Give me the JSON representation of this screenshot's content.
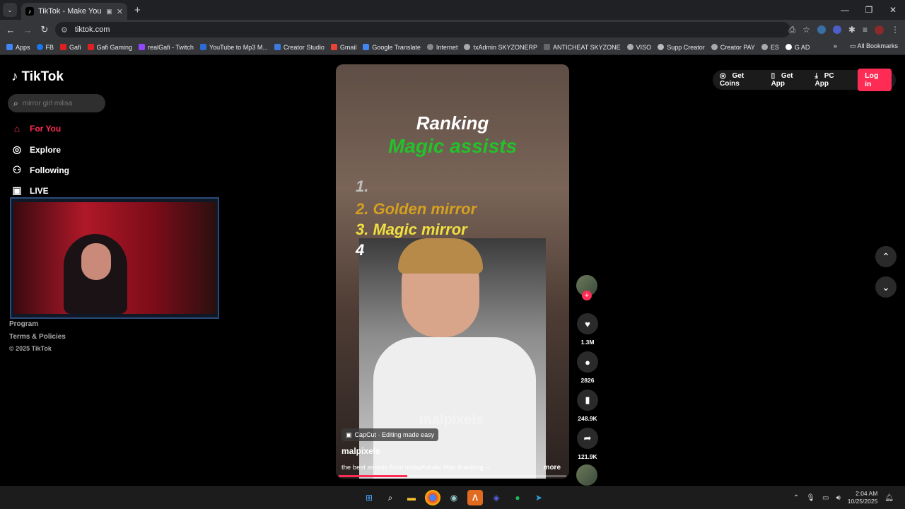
{
  "browser": {
    "tab_title": "TikTok - Make Your Day",
    "url": "tiktok.com",
    "bookmarks": [
      "Apps",
      "FB",
      "Gafi",
      "Gafi Gaming",
      "realGafi - Twitch",
      "YouTube to Mp3 M...",
      "Creator Studio",
      "Gmail",
      "Google Translate",
      "Internet",
      "txAdmin SKYZONERP",
      "ANTICHEAT SKYZONE",
      "VISO",
      "Supp Creator",
      "Creator PAY",
      "ES",
      "G AD"
    ],
    "all_bookmarks": "All Bookmarks"
  },
  "sidebar": {
    "logo": "TikTok",
    "search_placeholder": "mirror girl milisa",
    "nav": [
      {
        "label": "For You",
        "icon": "home-icon"
      },
      {
        "label": "Explore",
        "icon": "compass-icon"
      },
      {
        "label": "Following",
        "icon": "user-follow-icon"
      },
      {
        "label": "LIVE",
        "icon": "live-icon"
      }
    ],
    "footer": [
      "Program",
      "Terms & Policies",
      "© 2025 TikTok"
    ]
  },
  "video": {
    "title_line1": "Ranking",
    "title_line2": "Magic assists",
    "ranks": [
      {
        "num": "1.",
        "text": "",
        "color": "#bfbfbf"
      },
      {
        "num": "2.",
        "text": "Golden mirror",
        "color": "#d4a020"
      },
      {
        "num": "3.",
        "text": "Magic mirror",
        "color": "#f0e040"
      },
      {
        "num": "4",
        "text": "",
        "color": "#ffffff"
      }
    ],
    "watermark": "malpixels",
    "capcut": "CapCut · Editing made easy",
    "author": "malpixels",
    "description": "the best assists from today#virale #fyp #ranking --",
    "more": "more",
    "progress": 0.3
  },
  "actions": {
    "likes": "1.3M",
    "comments": "2826",
    "saves": "248.9K",
    "shares": "121.9K"
  },
  "header": {
    "get_coins": "Get Coins",
    "get_app": "Get App",
    "pc_app": "PC App",
    "login": "Log in"
  },
  "taskbar": {
    "time": "2:04 AM",
    "date": "10/25/2025"
  }
}
